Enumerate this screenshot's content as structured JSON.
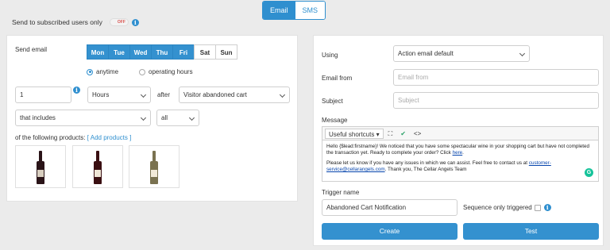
{
  "channel_tabs": {
    "email": "Email",
    "sms": "SMS"
  },
  "subscribed": {
    "label": "Send to subscribed users only",
    "toggle": "OFF"
  },
  "left": {
    "send_email_label": "Send email",
    "days": [
      {
        "label": "Mon",
        "on": true
      },
      {
        "label": "Tue",
        "on": true
      },
      {
        "label": "Wed",
        "on": true
      },
      {
        "label": "Thu",
        "on": true
      },
      {
        "label": "Fri",
        "on": true
      },
      {
        "label": "Sat",
        "on": false
      },
      {
        "label": "Sun",
        "on": false
      }
    ],
    "radio_anytime": "anytime",
    "radio_operating": "operating hours",
    "delay_value": "1",
    "unit": "Hours",
    "after_label": "after",
    "trigger": "Visitor abandoned cart",
    "condition": "that includes",
    "scope": "all",
    "products_label": "of the following products:",
    "add_products": "[ Add products ]",
    "products": [
      {
        "body_color": "#2a1418",
        "label_color": "#d9cfc0"
      },
      {
        "body_color": "#3a0f12",
        "label_color": "#efe6d6"
      },
      {
        "body_color": "#7a7250",
        "label_color": "#f2ead8"
      }
    ]
  },
  "right": {
    "using_label": "Using",
    "using_value": "Action email default",
    "email_from_label": "Email from",
    "email_from_placeholder": "Email from",
    "subject_label": "Subject",
    "subject_placeholder": "Subject",
    "message_label": "Message",
    "toolbar": {
      "shortcuts": "Useful shortcuts",
      "expand_glyph": "⛶",
      "check_glyph": "✔",
      "code_glyph": "<>"
    },
    "message": {
      "p1_pre": "Hello {$lead:firstname}! We noticed that you have some spectacular wine in your shopping cart but have not completed the transaction yet. Ready to complete your order? Click ",
      "p1_link": "here",
      "p1_post": ".",
      "p2_pre": "Please let us know if you have any issues in which we can assist. Feel free to contact us at ",
      "p2_link": "customer-service@cellarangels.com",
      "p2_post": ". Thank you, The Cellar Angels Team"
    },
    "trigger_name_label": "Trigger name",
    "trigger_name_value": "Abandoned Cart Notification",
    "sequence_label": "Sequence only triggered",
    "create_label": "Create",
    "test_label": "Test"
  }
}
